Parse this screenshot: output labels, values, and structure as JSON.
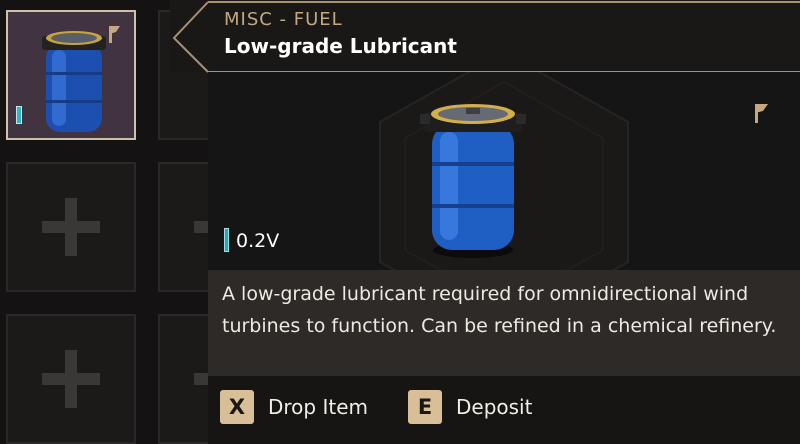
{
  "tooltip": {
    "category": "MISC - FUEL",
    "title": "Low-grade Lubricant",
    "voltage": "0.2V",
    "description": "A low-grade lubricant required for omnidirectional wind turbines to function. Can be refined in a chemical refinery."
  },
  "actions": [
    {
      "key": "X",
      "label": "Drop Item"
    },
    {
      "key": "E",
      "label": "Deposit"
    }
  ],
  "icons": {
    "item": "blue-barrel-icon",
    "tag": "tag-flag-icon",
    "empty_slot": "plus-icon"
  },
  "colors": {
    "accent_gold": "#c4a882",
    "key_cap": "#d9bf97",
    "voltage_teal": "#2aa7b3",
    "barrel_blue": "#1f5fc4"
  }
}
